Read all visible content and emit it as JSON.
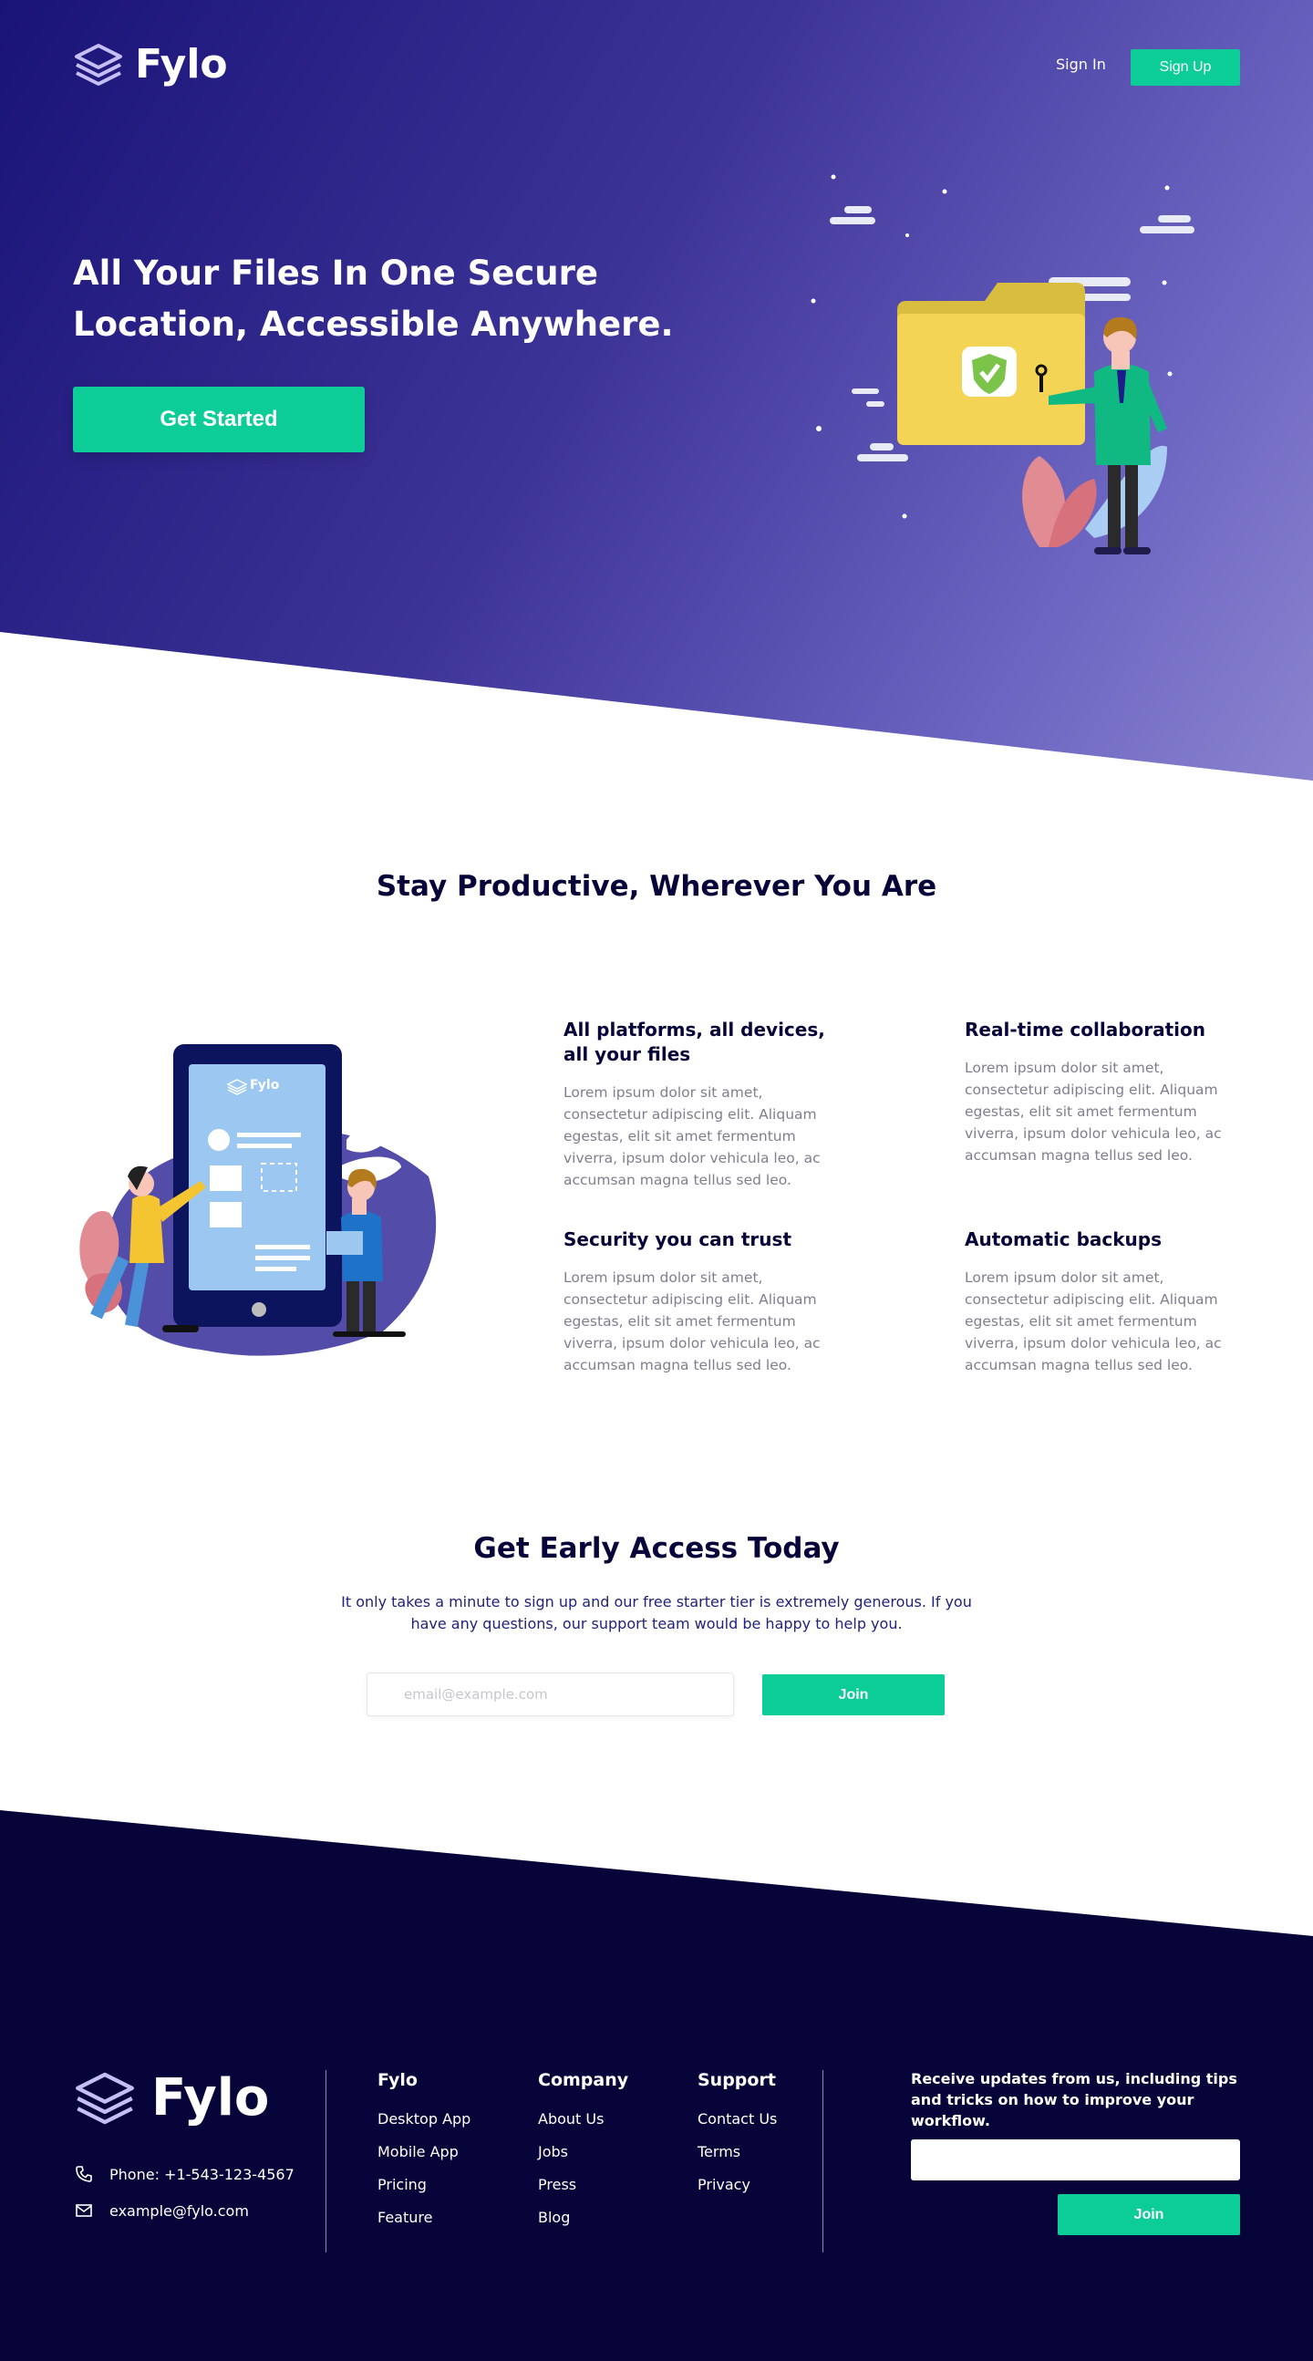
{
  "brand": {
    "name": "Fylo",
    "accent": "#0ccd97",
    "dark": "#070439",
    "logo_icon": "layers-icon"
  },
  "nav": {
    "signin_label": "Sign In",
    "signup_label": "Sign Up"
  },
  "hero": {
    "title": "All Your Files In One Secure Location, Accessible Anywhere.",
    "cta_label": "Get Started",
    "illustration": "secure-folder-illustration"
  },
  "features": {
    "title": "Stay Productive, Wherever You Are",
    "illustration": "phone-collaboration-illustration",
    "illustration_phone_logo": "Fylo",
    "items": [
      {
        "title": "All platforms, all devices, all your files",
        "text": "Lorem ipsum dolor sit amet, consectetur adipiscing elit. Aliquam egestas, elit sit amet fermentum viverra, ipsum dolor vehicula leo, ac accumsan magna tellus sed leo."
      },
      {
        "title": "Real-time collaboration",
        "text": "Lorem ipsum dolor sit amet, consectetur adipiscing elit. Aliquam egestas, elit sit amet fermentum viverra, ipsum dolor vehicula leo, ac accumsan magna tellus sed leo."
      },
      {
        "title": "Security you can trust",
        "text": "Lorem ipsum dolor sit amet, consectetur adipiscing elit. Aliquam egestas, elit sit amet fermentum viverra, ipsum dolor vehicula leo, ac accumsan magna tellus sed leo."
      },
      {
        "title": "Automatic backups",
        "text": "Lorem ipsum dolor sit amet, consectetur adipiscing elit. Aliquam egestas, elit sit amet fermentum viverra, ipsum dolor vehicula leo, ac accumsan magna tellus sed leo."
      }
    ]
  },
  "early_access": {
    "title": "Get Early Access Today",
    "description": "It only takes a minute to sign up and our free starter tier is extremely generous. If you have any questions, our support team would be happy to help you.",
    "email_placeholder": "email@example.com",
    "join_label": "Join"
  },
  "footer": {
    "phone": "Phone: +1-543-123-4567",
    "email": "example@fylo.com",
    "columns": [
      {
        "title": "Fylo",
        "links": [
          "Desktop App",
          "Mobile App",
          "Pricing",
          "Feature"
        ]
      },
      {
        "title": "Company",
        "links": [
          "About Us",
          "Jobs",
          "Press",
          "Blog"
        ]
      },
      {
        "title": "Support",
        "links": [
          "Contact Us",
          "Terms",
          "Privacy"
        ]
      }
    ],
    "newsletter_text": "Receive updates from us, including tips and tricks on how to improve your workflow.",
    "newsletter_button": "Join"
  }
}
